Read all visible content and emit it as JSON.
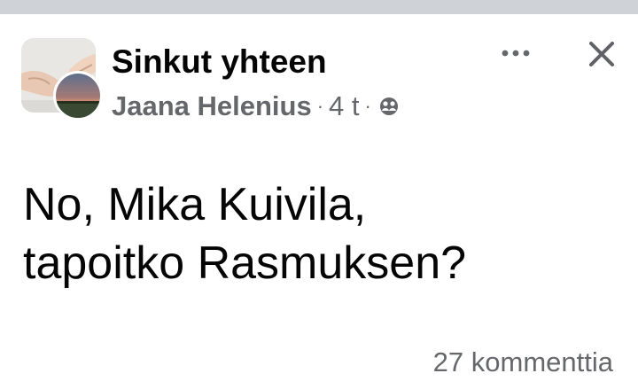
{
  "post": {
    "group_name": "Sinkut yhteen",
    "author": "Jaana Helenius",
    "separator": "·",
    "time": "4 t",
    "privacy_icon": "group-privacy-icon",
    "more_icon": "more-options-icon",
    "close_icon": "close-icon",
    "text_line1": "No, Mika Kuivila,",
    "text_line2": "tapoitko Rasmuksen?",
    "comments": "27 kommenttia"
  },
  "colors": {
    "primary_text": "#050505",
    "secondary_text": "#65676b",
    "top_strip": "#cfd2d6"
  }
}
